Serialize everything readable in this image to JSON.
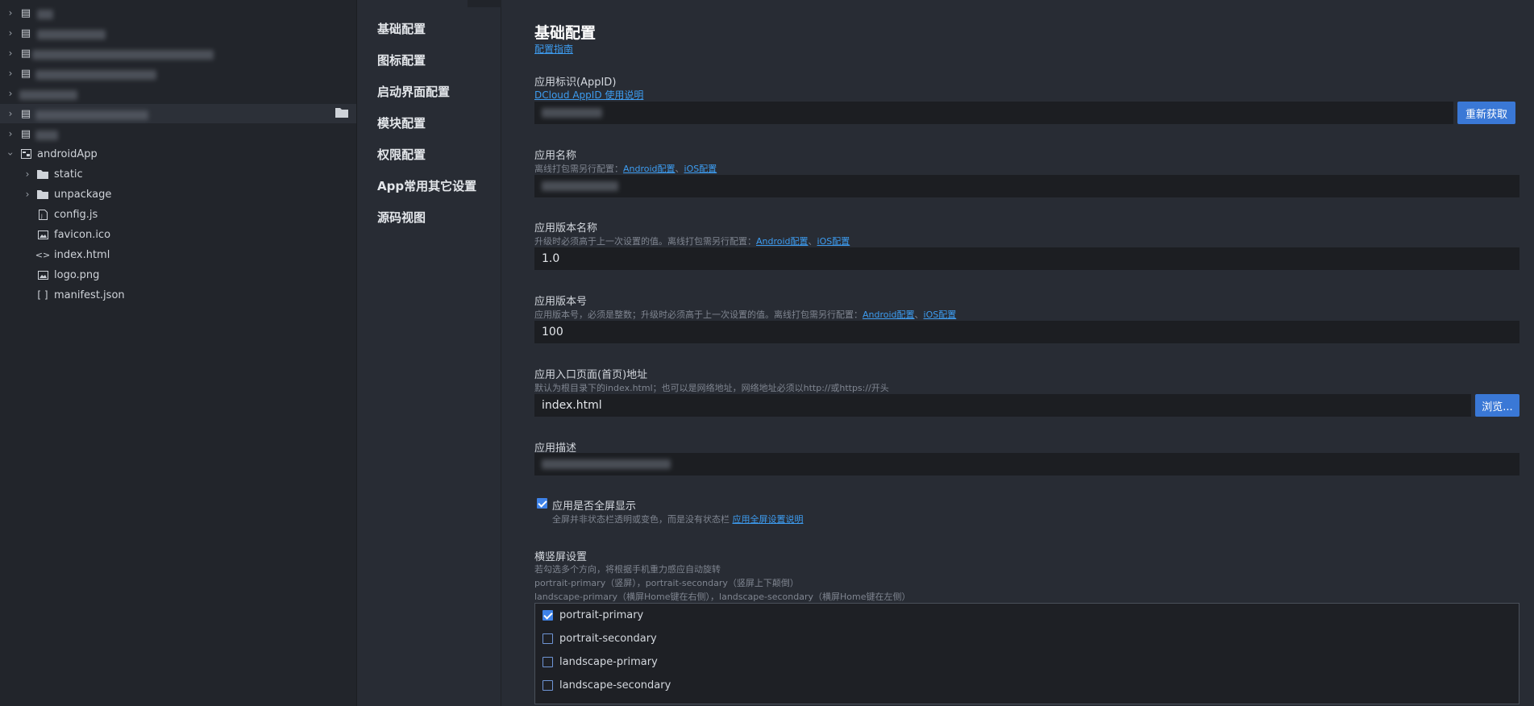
{
  "tree": {
    "items": [
      {
        "label": "androidApp",
        "icon": "project-icon"
      },
      {
        "label": "static",
        "icon": "folder-icon"
      },
      {
        "label": "unpackage",
        "icon": "folder-icon"
      },
      {
        "label": "config.js",
        "icon": "js-file-icon"
      },
      {
        "label": "favicon.ico",
        "icon": "image-file-icon"
      },
      {
        "label": "index.html",
        "icon": "html-file-icon"
      },
      {
        "label": "logo.png",
        "icon": "image-file-icon"
      },
      {
        "label": "manifest.json",
        "icon": "json-file-icon"
      }
    ]
  },
  "nav": {
    "items": [
      "基础配置",
      "图标配置",
      "启动界面配置",
      "模块配置",
      "权限配置",
      "App常用其它设置",
      "源码视图"
    ]
  },
  "main": {
    "title": "基础配置",
    "guide_link": "配置指南",
    "appid": {
      "label": "应用标识(AppID)",
      "link": "DCloud AppID 使用说明",
      "button": "重新获取"
    },
    "app_name": {
      "label": "应用名称",
      "hint": "离线打包需另行配置：",
      "android_link": "Android配置",
      "sep": "、",
      "ios_link": "iOS配置"
    },
    "version_name": {
      "label": "应用版本名称",
      "hint": "升级时必须高于上一次设置的值。离线打包需另行配置：",
      "android_link": "Android配置",
      "sep": "、",
      "ios_link": "iOS配置",
      "value": "1.0"
    },
    "version_code": {
      "label": "应用版本号",
      "hint": "应用版本号，必须是整数；升级时必须高于上一次设置的值。离线打包需另行配置：",
      "android_link": "Android配置",
      "sep": "、",
      "ios_link": "iOS配置",
      "value": "100"
    },
    "entry": {
      "label": "应用入口页面(首页)地址",
      "hint": "默认为根目录下的index.html；也可以是网络地址，网络地址必须以http://或https://开头",
      "value": "index.html",
      "button": "浏览..."
    },
    "description": {
      "label": "应用描述"
    },
    "fullscreen": {
      "label": "应用是否全屏显示",
      "checked": true,
      "hint": "全屏并非状态栏透明或变色，而是没有状态栏",
      "link": "应用全屏设置说明"
    },
    "orientation": {
      "label": "横竖屏设置",
      "hint1": "若勾选多个方向，将根据手机重力感应自动旋转",
      "hint2": "portrait-primary（竖屏），portrait-secondary（竖屏上下颠倒）",
      "hint3": "landscape-primary（横屏Home键在右侧），landscape-secondary（横屏Home键在左侧）",
      "options": [
        {
          "label": "portrait-primary",
          "checked": true
        },
        {
          "label": "portrait-secondary",
          "checked": false
        },
        {
          "label": "landscape-primary",
          "checked": false
        },
        {
          "label": "landscape-secondary",
          "checked": false
        }
      ]
    }
  },
  "colors": {
    "accent": "#3a78d6",
    "link": "#3d9cf0",
    "background": "#282c34",
    "input_bg": "#1c1e22"
  }
}
